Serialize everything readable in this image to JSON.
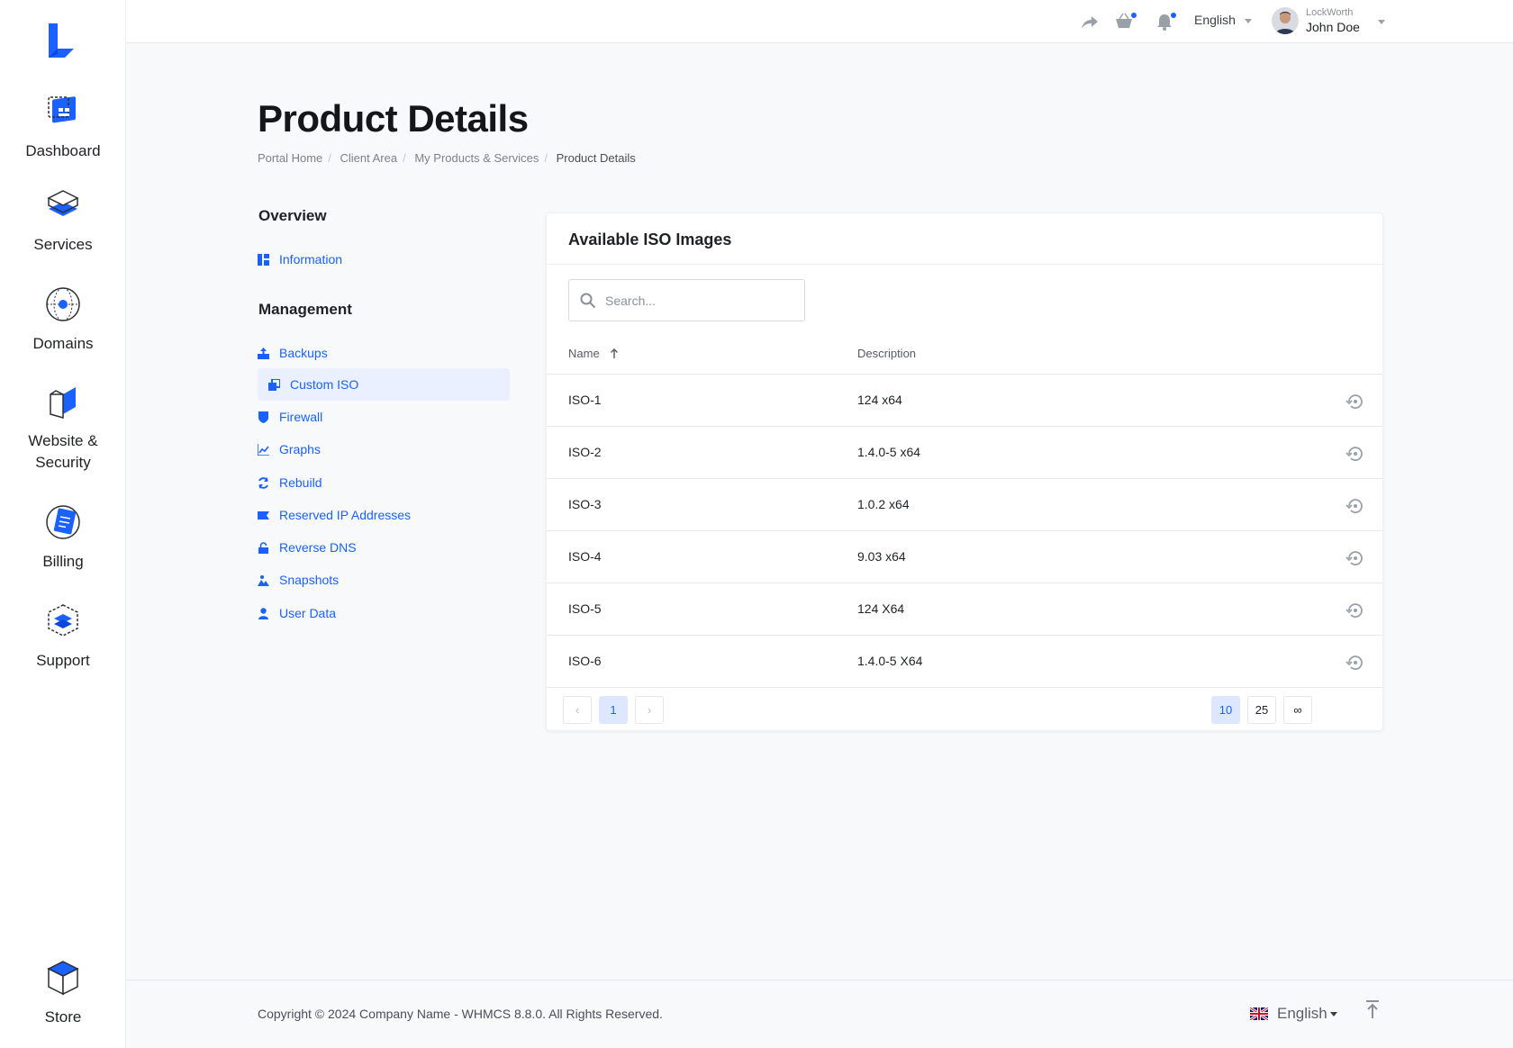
{
  "sidebar": {
    "items": [
      {
        "label": "Dashboard",
        "icon": "dashboard-icon"
      },
      {
        "label": "Services",
        "icon": "services-icon"
      },
      {
        "label": "Domains",
        "icon": "domains-icon"
      },
      {
        "label": "Website &\nSecurity",
        "icon": "website-security-icon"
      },
      {
        "label": "Billing",
        "icon": "billing-icon"
      },
      {
        "label": "Support",
        "icon": "support-icon"
      },
      {
        "label": "Store",
        "icon": "store-icon"
      }
    ]
  },
  "topbar": {
    "language": "English",
    "user_company": "LockWorth",
    "user_name": "John Doe"
  },
  "page": {
    "title": "Product Details",
    "breadcrumb": [
      "Portal Home",
      "Client Area",
      "My Products & Services",
      "Product Details"
    ]
  },
  "side_menu": {
    "overview_heading": "Overview",
    "overview_items": [
      {
        "label": "Information",
        "icon": "info-icon"
      }
    ],
    "management_heading": "Management",
    "management_items": [
      {
        "label": "Backups",
        "icon": "backups-icon"
      },
      {
        "label": "Custom ISO",
        "icon": "custom-iso-icon",
        "active": true
      },
      {
        "label": "Firewall",
        "icon": "firewall-icon"
      },
      {
        "label": "Graphs",
        "icon": "graphs-icon"
      },
      {
        "label": "Rebuild",
        "icon": "rebuild-icon"
      },
      {
        "label": "Reserved IP Addresses",
        "icon": "reserved-ip-icon"
      },
      {
        "label": "Reverse DNS",
        "icon": "reverse-dns-icon"
      },
      {
        "label": "Snapshots",
        "icon": "snapshots-icon"
      },
      {
        "label": "User Data",
        "icon": "user-data-icon"
      }
    ]
  },
  "panel": {
    "title": "Available ISO Images",
    "search_placeholder": "Search...",
    "columns": [
      "Name",
      "Description"
    ],
    "rows": [
      {
        "name": "ISO-1",
        "description": "124 x64"
      },
      {
        "name": "ISO-2",
        "description": "1.4.0-5 x64"
      },
      {
        "name": "ISO-3",
        "description": "1.0.2 x64"
      },
      {
        "name": "ISO-4",
        "description": "9.03 x64"
      },
      {
        "name": "ISO-5",
        "description": "124 X64"
      },
      {
        "name": "ISO-6",
        "description": "1.4.0-5 X64"
      }
    ],
    "pagination": {
      "prev": "‹",
      "current": "1",
      "next": "›"
    },
    "page_sizes": [
      "10",
      "25",
      "∞"
    ],
    "active_page_size": "10"
  },
  "footer": {
    "copyright": "Copyright © 2024 Company Name - WHMCS 8.8.0. All Rights Reserved.",
    "language": "English"
  },
  "colors": {
    "accent": "#1a61ff",
    "active_bg": "#eaf0ff",
    "text": "#1f2125",
    "muted": "#7c828b"
  }
}
